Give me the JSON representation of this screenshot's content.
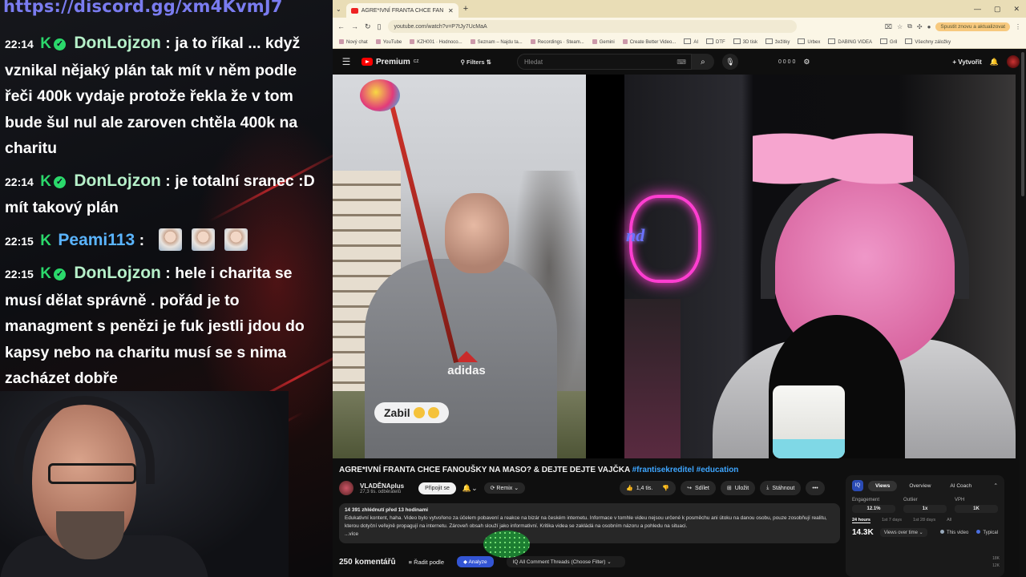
{
  "overlay": {
    "discord_link": "https://discord.gg/xm4KvmJ7",
    "messages": [
      {
        "time": "22:14",
        "user": "DonLojzon",
        "text": ": ja to říkal ... když vznikal nějaký plán tak mít v něm podle řeči 400k vydaje protože řekla že v tom bude šul nul ale zaroven chtěla 400k na charitu"
      },
      {
        "time": "22:14",
        "user": "DonLojzon",
        "text": ": je totalní sranec :D mít takový plán"
      },
      {
        "time": "22:15",
        "user": "Peami113",
        "text": ":"
      },
      {
        "time": "22:15",
        "user": "DonLojzon",
        "text": ": hele i charita se musí dělat správně . pořád je to managment s penězi je fuk jestli jdou do kapsy nebo na charitu musí se s nima zacházet dobře"
      }
    ]
  },
  "browser": {
    "tab_title": "AGRE*IVNÍ FRANTA CHCE FAN",
    "url": "youtube.com/watch?v=P7tJy7UcMaA",
    "restart_label": "Spustit znovu a aktualizovat",
    "bookmarks": [
      "Nový chat",
      "YouTube",
      "KZH001 · Hodnoco...",
      "Seznam – Najdu ta...",
      "Recordings · Steam...",
      "Gemini",
      "Create Better Video...",
      "AI",
      "DTF",
      "3D tisk",
      "žežitky",
      "Urbex",
      "DABING VIDEA",
      "Gril",
      "Všechny záložky"
    ]
  },
  "youtube": {
    "logo": "Premium",
    "logo_sup": "CZ",
    "filters": "Filters",
    "search_placeholder": "Hledat",
    "top_stats": "0 0 0 0",
    "create": "Vytvořit",
    "video_caption": "Zabil",
    "neon_text": "nd",
    "jersey": "adidas",
    "title": "AGRE*IVNÍ FRANTA CHCE FANOUŠKY NA MASO? & DEJTE DEJTE VAJČKA ",
    "tags": "#frantisekreditel #education",
    "channel": "VLADĚNAplus",
    "subscribers": "27,3 tis. odběratelů",
    "join": "Připojit se",
    "remix": "Remix",
    "likes": "1,4 tis.",
    "share": "Sdílet",
    "save": "Uložit",
    "download": "Stáhnout",
    "desc_stats": "14 391 zhlédnutí  před 13 hodinami",
    "desc_text": "Edukativní kontent, haha. Video bylo vytvořeno za účelem pobavení a reakce na bizár na českém internetu. Informace v tomhle videu nejsou určené k posměchu ani útoku na danou osobu, pouze zosobňují realitu, kterou dotyční veřejně propagují na internetu. Zároveň obsah slouží jako informativní. Kritika videa se zakládá na osobním názoru a pohledu na situaci.",
    "desc_more": "...více",
    "comments_count": "250 komentářů",
    "sort": "Řadit podle",
    "analyze": "Analyze",
    "threads": "All Comment Threads (Choose Filter)"
  },
  "panel": {
    "badge": "IQ",
    "tabs": [
      "Views",
      "Overview",
      "AI Coach"
    ],
    "metrics": [
      {
        "label": "Engagement",
        "value": "12.1%"
      },
      {
        "label": "Outlier",
        "value": "1x"
      },
      {
        "label": "VPH",
        "value": "1K"
      }
    ],
    "times": [
      "24 hours",
      "1st 7 days",
      "1st 28 days",
      "All"
    ],
    "views": "14.3K",
    "views_select": "Views over time",
    "legend": [
      "This video",
      "Typical"
    ],
    "axis": [
      "18K",
      "12K"
    ]
  }
}
